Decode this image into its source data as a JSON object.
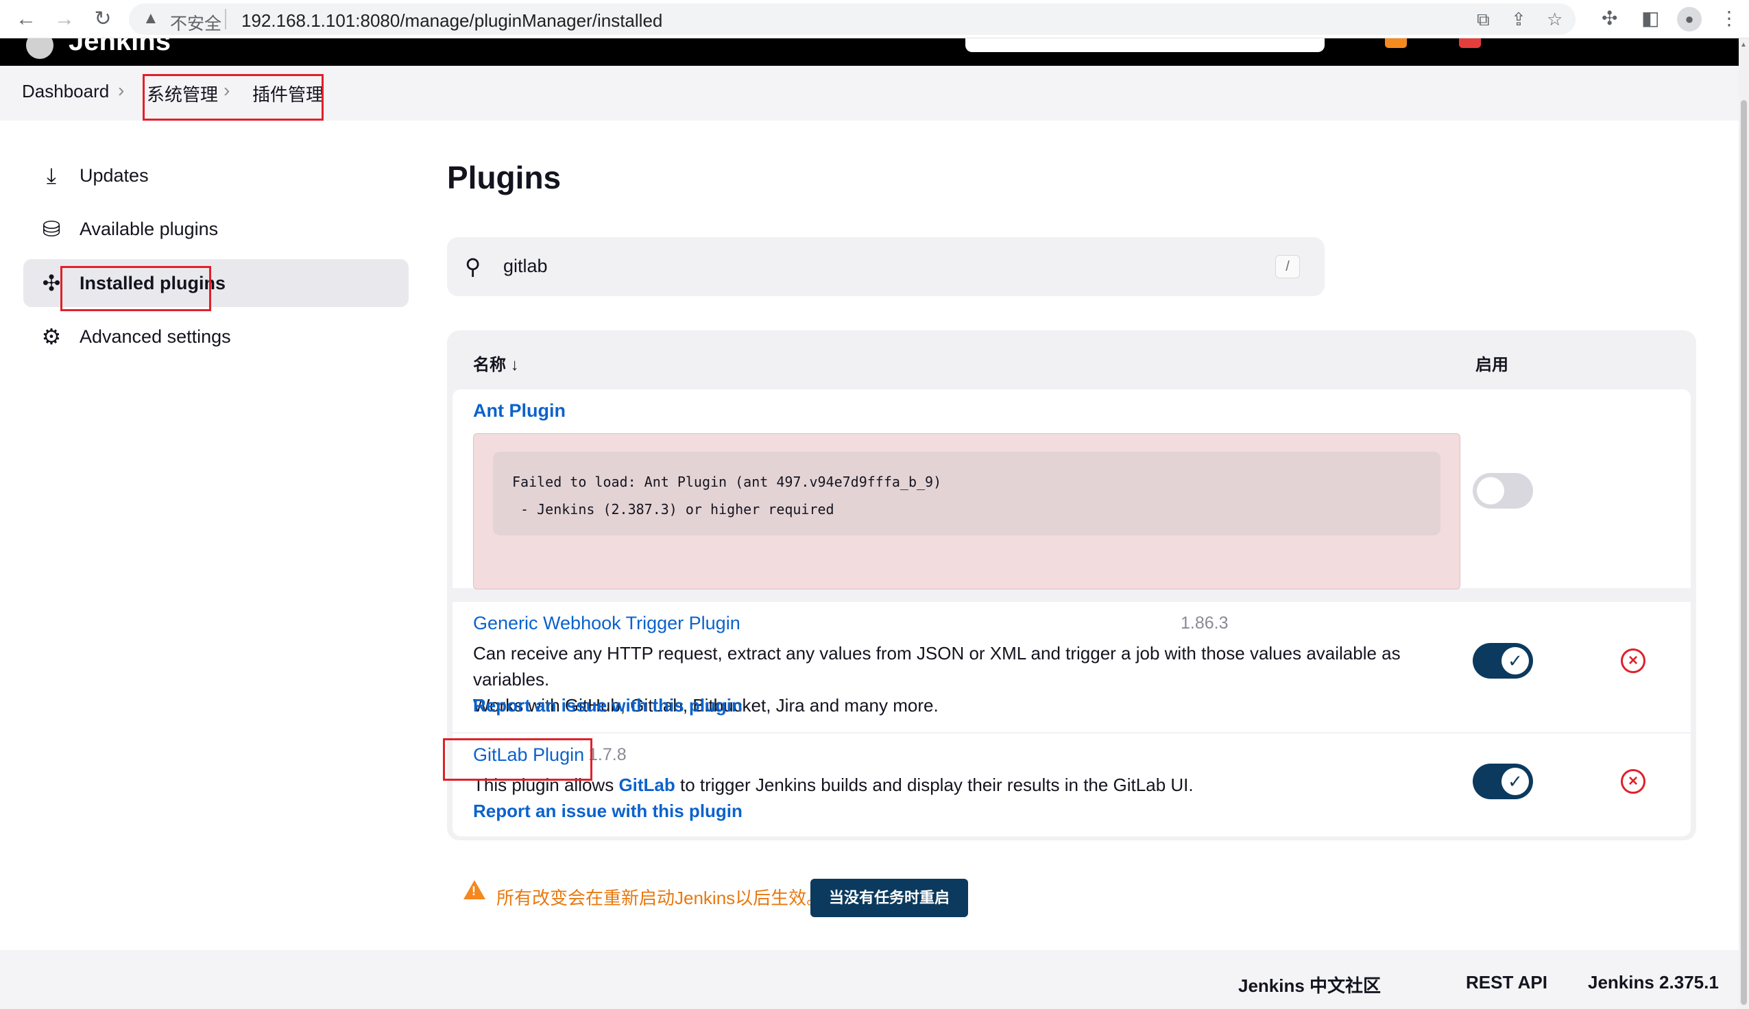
{
  "browser": {
    "insecure_label": "不安全",
    "url": "192.168.1.101:8080/manage/pluginManager/installed",
    "icons": [
      "back-icon",
      "forward-icon",
      "reload-icon",
      "translate-icon",
      "share-icon",
      "star-icon",
      "extensions-icon",
      "sidebar-icon",
      "profile-icon",
      "menu-icon"
    ]
  },
  "breadcrumb": {
    "items": [
      "Dashboard",
      "系统管理",
      "插件管理"
    ]
  },
  "sidebar": {
    "items": [
      {
        "label": "Updates",
        "icon": "download-icon"
      },
      {
        "label": "Available plugins",
        "icon": "shopping-bag-icon"
      },
      {
        "label": "Installed plugins",
        "icon": "puzzle-icon",
        "active": true
      },
      {
        "label": "Advanced settings",
        "icon": "gear-icon"
      }
    ]
  },
  "main": {
    "title": "Plugins",
    "search": {
      "value": "gitlab",
      "shortcut": "/"
    },
    "table": {
      "col_name": "名称 ↓",
      "col_enabled": "启用",
      "plugins": [
        {
          "name": "Ant Plugin",
          "error_line1": "Failed to load: Ant Plugin (ant 497.v94e7d9fffa_b_9)",
          "error_line2": " - Jenkins (2.387.3) or higher required",
          "enabled": false
        },
        {
          "name": "Generic Webhook Trigger Plugin",
          "version": "1.86.3",
          "description_line1": "Can receive any HTTP request, extract any values from JSON or XML and trigger a job with those values available as variables.",
          "description_line2": "Works with GitHub, GitLab, Bitbucket, Jira and many more.",
          "report_link": "Report an issue with this plugin",
          "enabled": true
        },
        {
          "name": "GitLab Plugin",
          "version": "1.7.8",
          "description_pre": "This plugin allows ",
          "description_link": "GitLab",
          "description_post": " to trigger Jenkins builds and display their results in the GitLab UI.",
          "report_link": "Report an issue with this plugin",
          "enabled": true
        }
      ]
    },
    "notice": "所有改变会在重新启动Jenkins以后生效。",
    "restart_button": "当没有任务时重启"
  },
  "footer": {
    "links": [
      "Jenkins 中文社区",
      "REST API",
      "Jenkins 2.375.1"
    ]
  },
  "colors": {
    "accent_blue": "#0b62cc",
    "toggle_on": "#0b3a5e",
    "error_bg": "#f2dcdd",
    "warning_orange": "#e8780e",
    "highlight_red": "#e0202a"
  }
}
